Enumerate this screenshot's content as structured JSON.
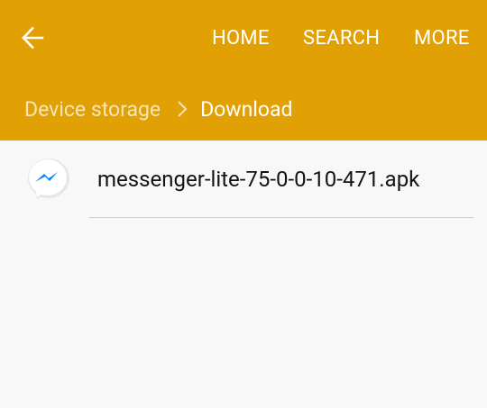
{
  "app_bar": {
    "background_color": "#e1a003",
    "back_icon": "arrow-left-icon",
    "actions": [
      {
        "label": "HOME"
      },
      {
        "label": "SEARCH"
      },
      {
        "label": "MORE"
      }
    ]
  },
  "breadcrumb": {
    "root_label": "Device storage",
    "separator_icon": "chevron-right-icon",
    "current_label": "Download"
  },
  "files": [
    {
      "name": "messenger-lite-75-0-0-10-471.apk",
      "icon": "messenger-icon",
      "icon_color": "#0084ff"
    }
  ]
}
